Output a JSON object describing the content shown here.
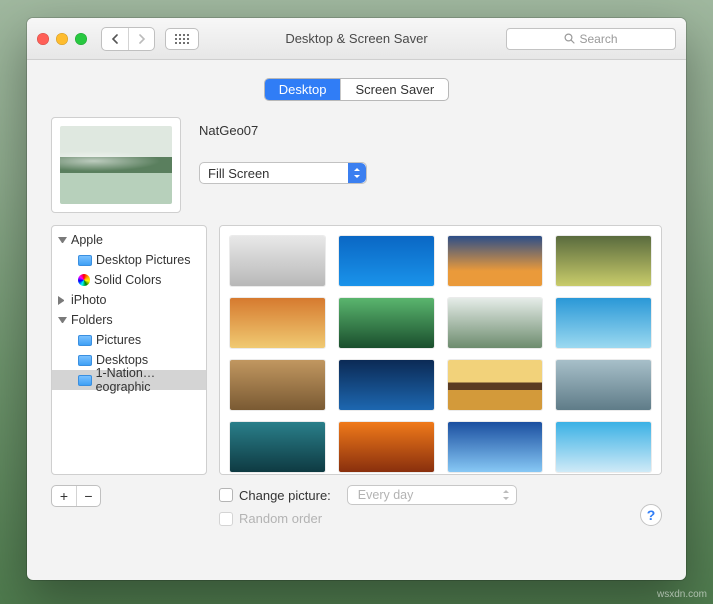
{
  "window": {
    "title": "Desktop & Screen Saver",
    "search_placeholder": "Search"
  },
  "tabs": {
    "active": "Desktop",
    "items": [
      {
        "label": "Desktop"
      },
      {
        "label": "Screen Saver"
      }
    ]
  },
  "wallpaper": {
    "name": "NatGeo07",
    "display_mode": "Fill Screen"
  },
  "sidebar": {
    "groups": [
      {
        "label": "Apple",
        "expanded": true,
        "children": [
          {
            "label": "Desktop Pictures",
            "icon": "folder"
          },
          {
            "label": "Solid Colors",
            "icon": "colorwheel"
          }
        ]
      },
      {
        "label": "iPhoto",
        "expanded": false,
        "children": []
      },
      {
        "label": "Folders",
        "expanded": true,
        "children": [
          {
            "label": "Pictures",
            "icon": "folder"
          },
          {
            "label": "Desktops",
            "icon": "folder"
          },
          {
            "label": "1-Nation…eographic",
            "icon": "folder",
            "selected": true
          }
        ]
      }
    ]
  },
  "thumbnails": {
    "count": 17
  },
  "footer": {
    "change_picture_label": "Change picture:",
    "change_picture_checked": false,
    "interval": "Every day",
    "random_order_label": "Random order",
    "random_order_enabled": false
  }
}
